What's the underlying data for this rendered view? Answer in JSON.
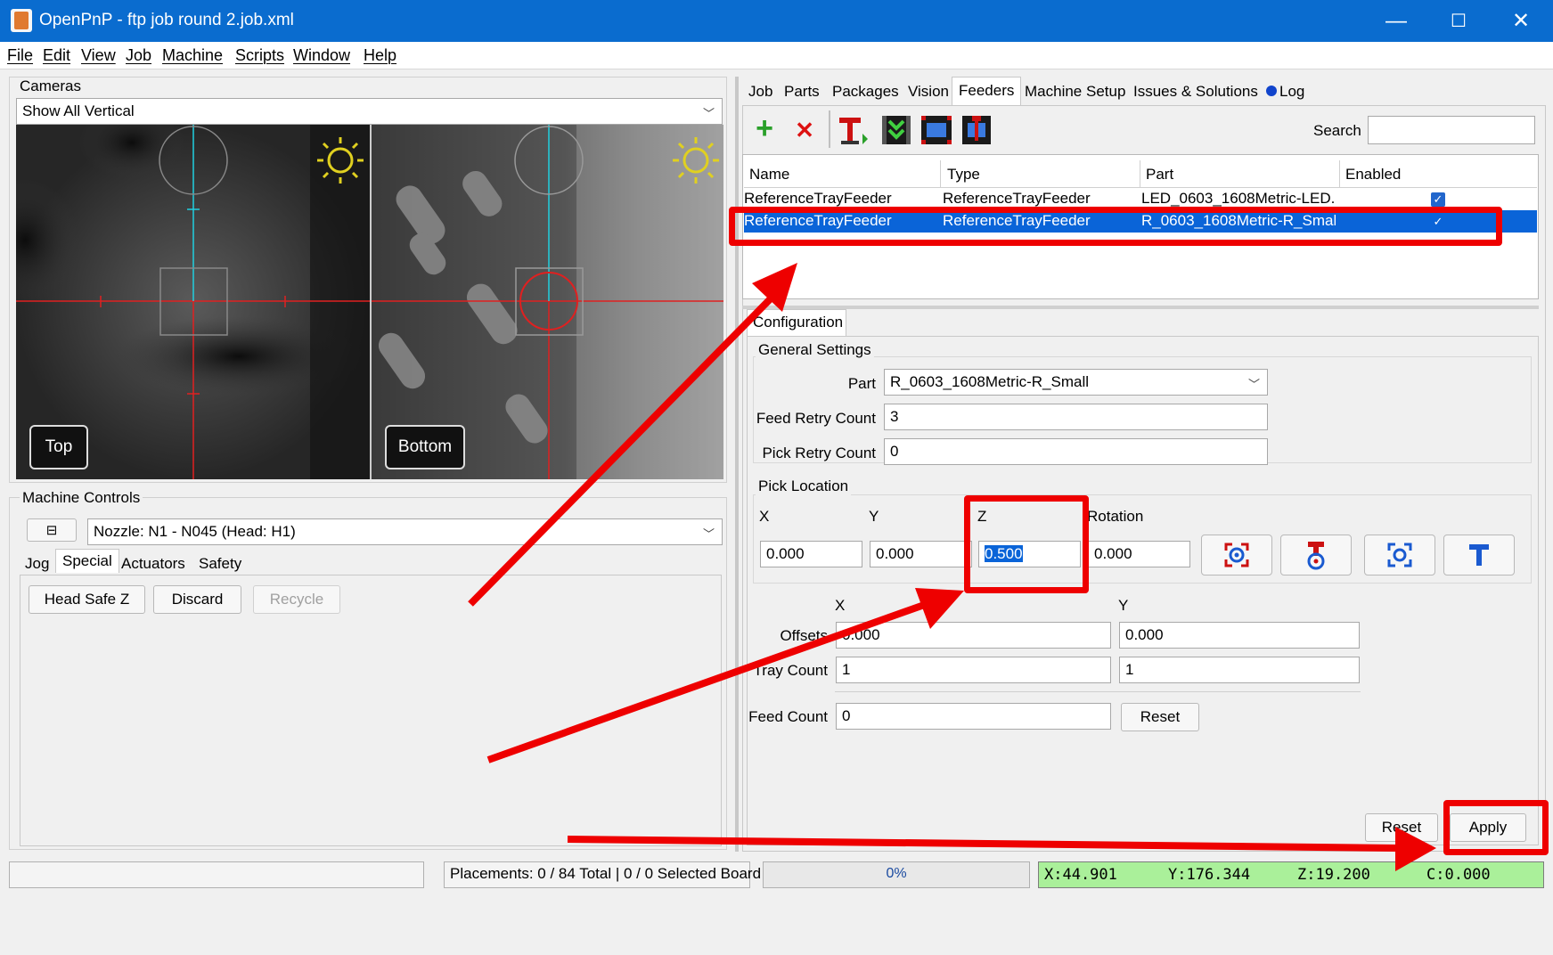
{
  "window": {
    "title": "OpenPnP - ftp job round 2.job.xml",
    "minimize": "—",
    "maximize": "☐",
    "close": "✕"
  },
  "menu": [
    "File",
    "Edit",
    "View",
    "Job",
    "Machine",
    "Scripts",
    "Window",
    "Help"
  ],
  "cameras": {
    "group_label": "Cameras",
    "view_mode": "Show All Vertical",
    "top_label": "Top",
    "bottom_label": "Bottom"
  },
  "machine_controls": {
    "group_label": "Machine Controls",
    "collapse_symbol": "⊟",
    "nozzle": "Nozzle: N1 - N045 (Head: H1)",
    "tabs": [
      "Jog",
      "Special",
      "Actuators",
      "Safety"
    ],
    "active_tab": "Special",
    "buttons": {
      "head_safe_z": "Head Safe Z",
      "discard": "Discard",
      "recycle": "Recycle"
    }
  },
  "right_tabs": {
    "items": [
      "Job",
      "Parts",
      "Packages",
      "Vision",
      "Feeders",
      "Machine Setup",
      "Issues & Solutions",
      "Log"
    ],
    "active": "Feeders"
  },
  "toolbar": {
    "icons": [
      "add-feeder-icon",
      "delete-feeder-icon",
      "pick-feeder-icon",
      "feed-feeder-icon",
      "move-camera-to-feeder-icon",
      "move-tool-to-feeder-icon"
    ],
    "add": "+",
    "delete": "✕",
    "search_label": "Search",
    "search_value": ""
  },
  "feeders_table": {
    "columns": [
      "Name",
      "Type",
      "Part",
      "Enabled"
    ],
    "rows": [
      {
        "name": "ReferenceTrayFeeder",
        "type": "ReferenceTrayFeeder",
        "part": "LED_0603_1608Metric-LED...",
        "enabled": "✓",
        "selected": false
      },
      {
        "name": "ReferenceTrayFeeder",
        "type": "ReferenceTrayFeeder",
        "part": "R_0603_1608Metric-R_Small",
        "enabled": "✓",
        "selected": true
      }
    ]
  },
  "configuration": {
    "tab_label": "Configuration",
    "general": {
      "group_label": "General Settings",
      "part_label": "Part",
      "part_value": "R_0603_1608Metric-R_Small",
      "feed_retry_label": "Feed Retry Count",
      "feed_retry_value": "3",
      "pick_retry_label": "Pick Retry Count",
      "pick_retry_value": "0"
    },
    "pick_location": {
      "group_label": "Pick Location",
      "x_label": "X",
      "y_label": "Y",
      "z_label": "Z",
      "rotation_label": "Rotation",
      "x": "0.000",
      "y": "0.000",
      "z": "0.500",
      "rotation": "0.000"
    },
    "offsets": {
      "x_header": "X",
      "y_header": "Y",
      "offsets_label": "Offsets",
      "offset_x": "0.000",
      "offset_y": "0.000",
      "tray_count_label": "Tray Count",
      "tray_x": "1",
      "tray_y": "1",
      "feed_count_label": "Feed Count",
      "feed_count": "0",
      "reset_label": "Reset"
    },
    "reset_label": "Reset",
    "apply_label": "Apply"
  },
  "status_bar": {
    "placements": "Placements: 0 / 84 Total | 0 / 0 Selected Board",
    "progress_text": "0%",
    "progress": 0,
    "dro": {
      "x": "X:44.901",
      "y": "Y:176.344",
      "z": "Z:19.200",
      "c": "C:0.000"
    }
  },
  "colors": {
    "title_bar": "#0a6ccf",
    "selection": "#0a64d8",
    "annotation": "#ee0000",
    "dro_bg": "#aaf09a"
  }
}
